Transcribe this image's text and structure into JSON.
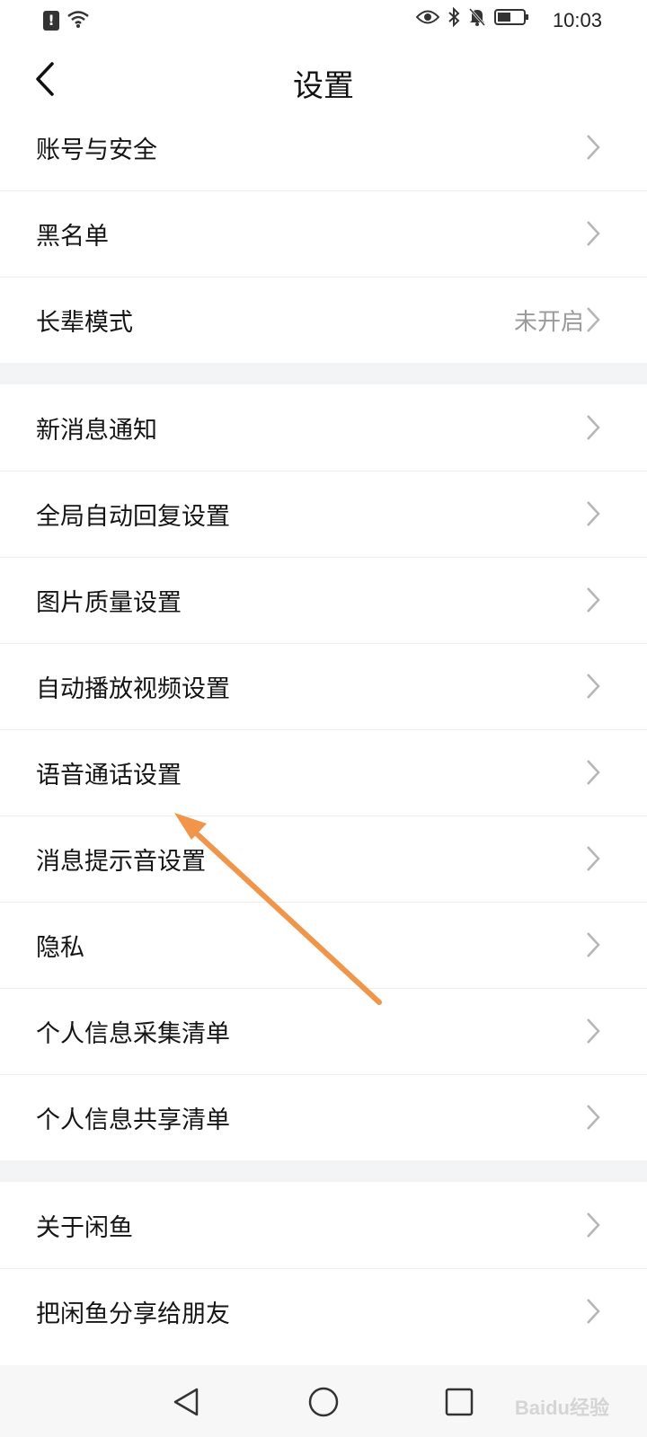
{
  "status_bar": {
    "time": "10:03",
    "alert_icon_text": "!",
    "icons": [
      "alert-icon",
      "wifi-icon",
      "eye-icon",
      "bluetooth-icon",
      "mute-bell-icon",
      "battery-icon"
    ]
  },
  "header": {
    "title": "设置",
    "back_icon": "chevron-left-icon"
  },
  "groups": [
    {
      "items": [
        {
          "label": "账号与安全",
          "value": ""
        },
        {
          "label": "黑名单",
          "value": ""
        },
        {
          "label": "长辈模式",
          "value": "未开启"
        }
      ]
    },
    {
      "items": [
        {
          "label": "新消息通知",
          "value": ""
        },
        {
          "label": "全局自动回复设置",
          "value": ""
        },
        {
          "label": "图片质量设置",
          "value": ""
        },
        {
          "label": "自动播放视频设置",
          "value": ""
        },
        {
          "label": "语音通话设置",
          "value": ""
        },
        {
          "label": "消息提示音设置",
          "value": ""
        },
        {
          "label": "隐私",
          "value": ""
        },
        {
          "label": "个人信息采集清单",
          "value": ""
        },
        {
          "label": "个人信息共享清单",
          "value": ""
        }
      ]
    },
    {
      "items": [
        {
          "label": "关于闲鱼",
          "value": ""
        },
        {
          "label": "把闲鱼分享给朋友",
          "value": ""
        }
      ]
    }
  ],
  "annotation": {
    "arrow_color": "#f0954a",
    "target": "语音通话设置"
  },
  "bottom_nav": {
    "buttons": [
      "back-triangle-icon",
      "home-circle-icon",
      "recents-square-icon"
    ]
  },
  "watermark": "Baidu经验",
  "colors": {
    "background": "#ffffff",
    "group_gap": "#f3f4f6",
    "divider": "#ececec",
    "secondary_text": "#9a9a9a",
    "chevron": "#b5b5b5"
  }
}
